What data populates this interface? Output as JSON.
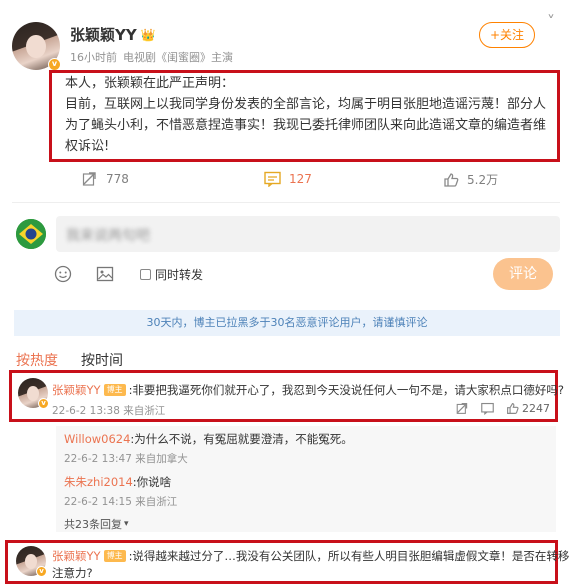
{
  "post": {
    "author_name": "张颖颖YY",
    "author_emoji": "👑",
    "meta_time": "16小时前",
    "meta_role": "电视剧《闺蜜圈》主演",
    "follow_label": "+关注",
    "menu_glyph": "˅",
    "body_line1": "本人，张颖颖在此严正声明：",
    "body_line2": "目前，互联网上以我同学身份发表的全部言论，均属于明目张胆地造谣污蔑！部分人",
    "body_line3": "为了蝇头小利，不惜恶意捏造事实！我现已委托律师团队来向此造谣文章的编造者维",
    "body_line4": "权诉讼!",
    "reposts": "778",
    "comments": "127",
    "likes": "5.2万"
  },
  "composer": {
    "placeholder_blurred": "我来说两句吧",
    "also_repost_label": "同时转发",
    "submit_label": "评论"
  },
  "notice": "30天内，博主已拉黑多于30名恶意评论用户，请谨慎评论",
  "tabs": {
    "hot": "按热度",
    "time": "按时间"
  },
  "comments": [
    {
      "name": "张颖颖YY",
      "tag": "博主",
      "text": ":非要把我逼死你们就开心了，我忍到今天没说任何人一句不是，请大家积点口德好吗?",
      "time": "22-6-2 13:38 来自浙江",
      "likes": "2247"
    },
    {
      "name": "张颖颖YY",
      "tag": "博主",
      "text_line1": ":说得越来越过分了…我没有公关团队，所以有些人明目张胆编辑虚假文章！是否在转移",
      "text_line2": "注意力?"
    }
  ],
  "replies": [
    {
      "name": "Willow0624",
      "text": ":为什么不说，有冤屈就要澄清，不能冤死。",
      "time": "22-6-2 13:47 来自加拿大"
    },
    {
      "name": "朱朱zhi2014",
      "text": ":你说啥",
      "time": "22-6-2 14:15 来自浙江"
    }
  ],
  "replies_more": "共23条回复",
  "colors": {
    "accent": "#ff8200",
    "highlight_border": "#c8101a",
    "username": "#eb7350"
  }
}
